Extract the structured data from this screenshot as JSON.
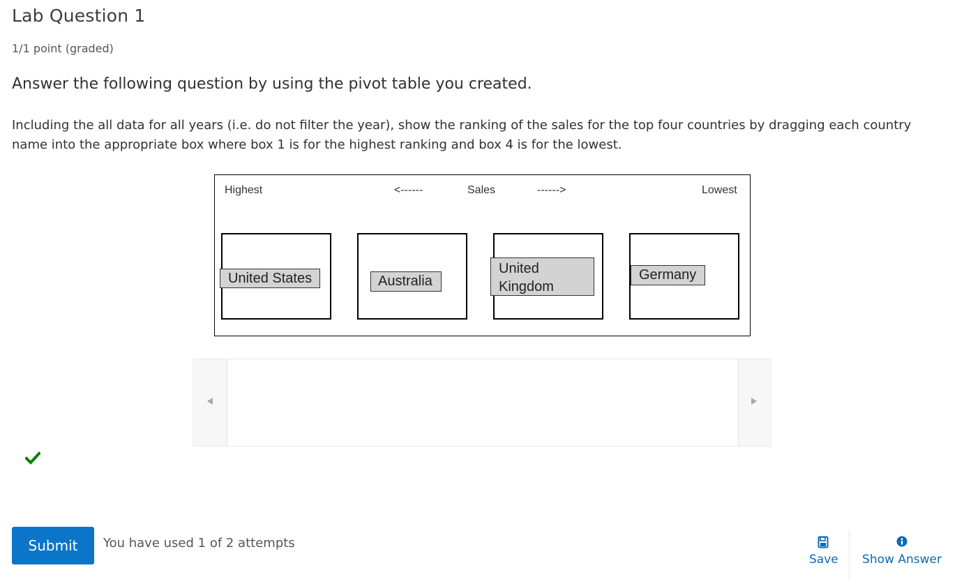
{
  "problem": {
    "title": "Lab Question 1",
    "score": "1/1 point (graded)",
    "heading": "Answer the following question by using the pivot table you created.",
    "instructions": "Including the all data for all years (i.e. do not filter the year), show the ranking of the sales for the top four countries by dragging each country name into the appropriate box where box 1 is for the highest ranking and box 4 is for the lowest."
  },
  "figure": {
    "highest": "Highest",
    "left_arrow": "<------",
    "sales": "Sales",
    "right_arrow": "------>",
    "lowest": "Lowest"
  },
  "placed_items": [
    {
      "label": "United States"
    },
    {
      "label": "Australia"
    },
    {
      "label": "United Kingdom"
    },
    {
      "label": "Germany"
    }
  ],
  "palette": {
    "prev_icon": "triangle-left",
    "next_icon": "triangle-right"
  },
  "status": {
    "icon": "checkmark",
    "color": "#008100"
  },
  "actions": {
    "submit": "Submit",
    "attempts": "You have used 1 of 2 attempts",
    "save": "Save",
    "show_answer": "Show Answer"
  },
  "colors": {
    "accent": "#0b75c9",
    "link": "#0b6ab3",
    "chip_bg": "#d3d3d3"
  }
}
